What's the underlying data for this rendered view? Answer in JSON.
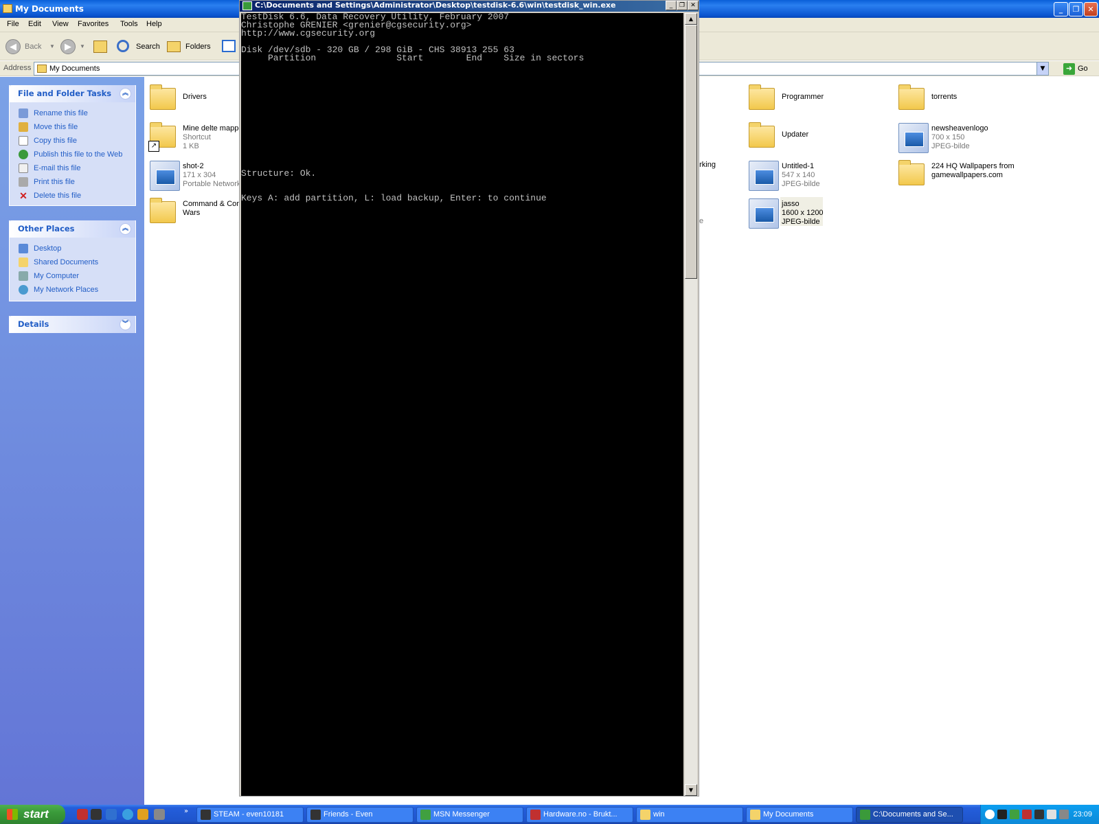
{
  "explorer": {
    "title": "My Documents",
    "menu": [
      "File",
      "Edit",
      "View",
      "Favorites",
      "Tools",
      "Help"
    ],
    "toolbar": {
      "back": "Back",
      "search": "Search",
      "folders": "Folders"
    },
    "address": {
      "label": "Address",
      "value": "My Documents",
      "go": "Go"
    },
    "tasks": {
      "header": "File and Folder Tasks",
      "items": [
        "Rename this file",
        "Move this file",
        "Copy this file",
        "Publish this file to the Web",
        "E-mail this file",
        "Print this file",
        "Delete this file"
      ]
    },
    "places": {
      "header": "Other Places",
      "items": [
        "Desktop",
        "Shared Documents",
        "My Computer",
        "My Network Places"
      ]
    },
    "details": {
      "header": "Details"
    },
    "files": [
      {
        "name": "Drivers"
      },
      {
        "name": "Mine delte mappe",
        "line2": "Shortcut",
        "line3": "1 KB"
      },
      {
        "name": "shot-2",
        "line2": "171 x 304",
        "line3": "Portable Network"
      },
      {
        "name": "Command & Conc",
        "name2": "Wars"
      },
      {
        "name": "Programmer"
      },
      {
        "name": "torrents"
      },
      {
        "name": "Updater"
      },
      {
        "name": "newsheavenlogo",
        "line2": "700 x 150",
        "line3": "JPEG-bilde"
      },
      {
        "name": "Untitled-1",
        "line2": "547 x 140",
        "line3": "JPEG-bilde"
      },
      {
        "name": "224 HQ Wallpapers from",
        "name2": "gamewallpapers.com"
      },
      {
        "name": "jasso",
        "line2": "1600 x 1200",
        "line3": "JPEG-bilde"
      }
    ],
    "partial": {
      "a": "orking",
      "b": "e"
    }
  },
  "cmd": {
    "title": "C:\\Documents and Settings\\Administrator\\Desktop\\testdisk-6.6\\win\\testdisk_win.exe",
    "lines": [
      "TestDisk 6.6, Data Recovery Utility, February 2007",
      "Christophe GRENIER <grenier@cgsecurity.org>",
      "http://www.cgsecurity.org",
      "",
      "Disk /dev/sdb - 320 GB / 298 GiB - CHS 38913 255 63",
      "     Partition               Start        End    Size in sectors",
      "Structure: Ok.",
      "Keys A: add partition, L: load backup, Enter: to continue"
    ]
  },
  "taskbar": {
    "start": "start",
    "tasks": [
      "STEAM - even10181",
      "Friends - Even",
      "MSN Messenger",
      "Hardware.no - Brukt...",
      "win",
      "My Documents",
      "C:\\Documents and Se..."
    ],
    "clock": "23:09"
  }
}
